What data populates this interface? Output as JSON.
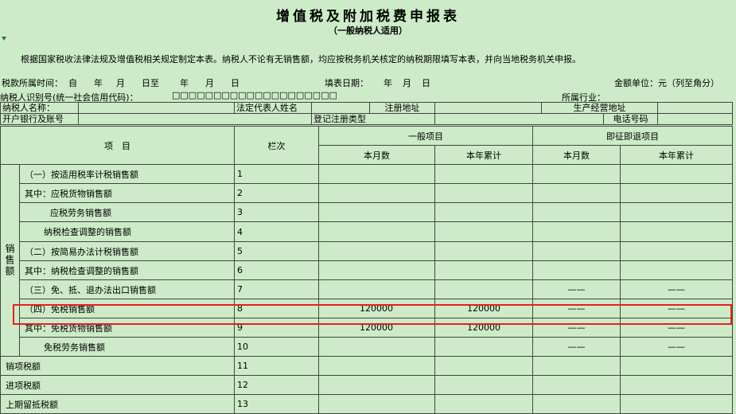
{
  "title": "增值税及附加税费申报表",
  "subtitle": "（一般纳税人适用）",
  "instruction": "根据国家税收法律法规及增值税相关规定制定本表。纳税人不论有无销售额，均应按税务机关核定的纳税期限填写本表，并向当地税务机关申报。",
  "period": {
    "label": "税款所属时间：",
    "from": "自",
    "year": "年",
    "month": "月",
    "day_to": "日至",
    "year2": "年",
    "month2": "月",
    "day2": "日",
    "fill_date_label": "填表日期：",
    "fill_year": "年",
    "fill_month": "月",
    "fill_day": "日",
    "unit": "金额单位：元（列至角分）"
  },
  "taxpayer": {
    "id_label": "纳税人识别号(统一社会信用代码)：",
    "id_boxes": "□□□□□□□□□□□□□□□□□□□□",
    "industry_label": "所属行业：",
    "name_label": "纳税人名称：",
    "legal_rep_label": "法定代表人姓名",
    "reg_address_label": "注册地址",
    "biz_address_label": "生产经营地址",
    "bank_label": "开户银行及账号",
    "reg_type_label": "登记注册类型",
    "phone_label": "电话号码"
  },
  "table": {
    "col_item": "项　目",
    "col_line": "栏次",
    "group_general": "一般项目",
    "group_refund": "即征即退项目",
    "col_month": "本月数",
    "col_year": "本年累计",
    "side_label": "销售额",
    "dash": "——",
    "rows": [
      {
        "label": "（一）按适用税率计税销售额",
        "line": "1",
        "gm": "",
        "gy": "",
        "rm": "",
        "ry": ""
      },
      {
        "label": "其中：应税货物销售额",
        "line": "2",
        "gm": "",
        "gy": "",
        "rm": "",
        "ry": ""
      },
      {
        "label": "应税劳务销售额",
        "line": "3",
        "gm": "",
        "gy": "",
        "rm": "",
        "ry": ""
      },
      {
        "label": "纳税检查调整的销售额",
        "line": "4",
        "gm": "",
        "gy": "",
        "rm": "",
        "ry": ""
      },
      {
        "label": "（二）按简易办法计税销售额",
        "line": "5",
        "gm": "",
        "gy": "",
        "rm": "",
        "ry": ""
      },
      {
        "label": "其中：纳税检查调整的销售额",
        "line": "6",
        "gm": "",
        "gy": "",
        "rm": "",
        "ry": ""
      },
      {
        "label": "（三）免、抵、退办法出口销售额",
        "line": "7",
        "gm": "",
        "gy": "",
        "rm": "——",
        "ry": "——"
      },
      {
        "label": "（四）免税销售额",
        "line": "8",
        "gm": "120000",
        "gy": "120000",
        "rm": "——",
        "ry": "——"
      },
      {
        "label": "其中：免税货物销售额",
        "line": "9",
        "gm": "120000",
        "gy": "120000",
        "rm": "——",
        "ry": "——"
      },
      {
        "label": "免税劳务销售额",
        "line": "10",
        "gm": "",
        "gy": "",
        "rm": "——",
        "ry": "——"
      },
      {
        "label": "销项税额",
        "line": "11",
        "gm": "",
        "gy": "",
        "rm": "",
        "ry": ""
      },
      {
        "label": "进项税额",
        "line": "12",
        "gm": "",
        "gy": "",
        "rm": "",
        "ry": ""
      },
      {
        "label": "上期留抵税额",
        "line": "13",
        "gm": "",
        "gy": "",
        "rm": "",
        "ry": ""
      }
    ]
  },
  "colors": {
    "background": "#cdebc8",
    "highlight": "#e8201c",
    "border": "#444444"
  }
}
